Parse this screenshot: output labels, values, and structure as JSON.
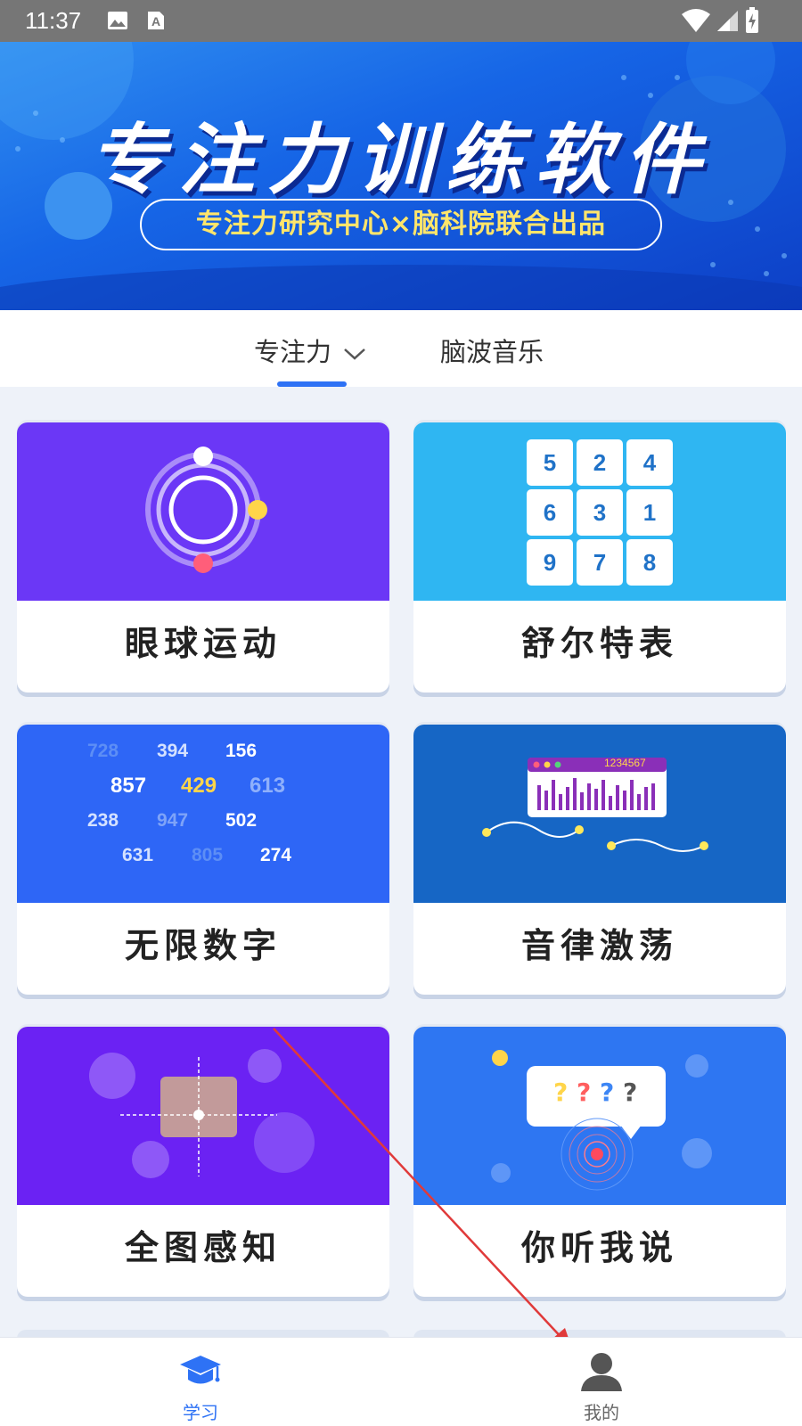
{
  "status_bar": {
    "time": "11:37",
    "icons": [
      "image-icon",
      "text-a-icon",
      "wifi-icon",
      "signal-icon",
      "battery-charging-icon"
    ]
  },
  "banner": {
    "title": "专注力训练软件",
    "subtitle": "专注力研究中心×脑科院联合出品"
  },
  "tabs": {
    "items": [
      {
        "label": "专注力",
        "active": true,
        "has_dropdown": true
      },
      {
        "label": "脑波音乐",
        "active": false
      }
    ],
    "accent": "#2e72f5"
  },
  "cards": [
    {
      "label": "眼球运动",
      "art_color": "#6b37f6",
      "icon": "eye-orbit-icon"
    },
    {
      "label": "舒尔特表",
      "art_color": "#2fb6f2",
      "icon": "number-grid-icon",
      "grid": [
        "5",
        "2",
        "4",
        "6",
        "3",
        "1",
        "9",
        "7",
        "8"
      ]
    },
    {
      "label": "无限数字",
      "art_color": "#2e66f6",
      "icon": "number-cloud-icon",
      "numbers": [
        [
          "728",
          "394",
          "156"
        ],
        [
          "857",
          "429",
          "613"
        ],
        [
          "238",
          "947",
          "502"
        ],
        [
          "631",
          "805",
          "274"
        ]
      ]
    },
    {
      "label": "音律激荡",
      "art_color": "#1666c5",
      "icon": "audio-waveform-icon",
      "window_caption": "1234567"
    },
    {
      "label": "全图感知",
      "art_color": "#6b22f3",
      "icon": "crosshair-focus-icon"
    },
    {
      "label": "你听我说",
      "art_color": "#2e76f2",
      "icon": "speech-bubble-icon",
      "bubble_text": [
        "?",
        "?",
        "?",
        "?"
      ]
    }
  ],
  "bottom_nav": {
    "items": [
      {
        "label": "学习",
        "icon": "graduation-cap-icon",
        "active": true,
        "color": "#2e72f5"
      },
      {
        "label": "我的",
        "icon": "user-profile-icon",
        "active": false,
        "color": "#666666"
      }
    ]
  }
}
